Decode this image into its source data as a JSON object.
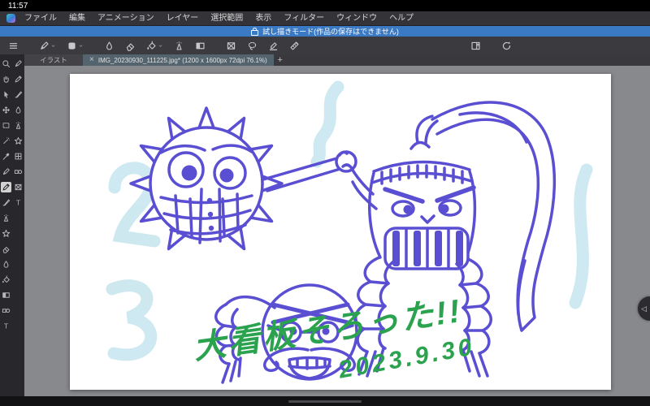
{
  "status_bar": {
    "time": "11:57"
  },
  "menu_bar": {
    "items": [
      "ファイル",
      "編集",
      "アニメーション",
      "レイヤー",
      "選択範囲",
      "表示",
      "フィルター",
      "ウィンドウ",
      "ヘルプ"
    ]
  },
  "banner": {
    "text": "試し描きモード(作品の保存はできません)"
  },
  "toolbar": {
    "left": [
      {
        "name": "main-menu",
        "icon": "menu"
      },
      {
        "name": "current-tool",
        "icon": "pen",
        "chevron": true
      },
      {
        "name": "color-swatch",
        "icon": "swatch",
        "chevron": true
      },
      {
        "name": "blend-tool",
        "icon": "droplet"
      },
      {
        "name": "eraser-tool",
        "icon": "eraser"
      },
      {
        "name": "fill-tool",
        "icon": "bucket",
        "chevron": true
      },
      {
        "name": "airbrush-tool",
        "icon": "airbrush"
      },
      {
        "name": "gradient-tool",
        "icon": "gradient"
      },
      {
        "name": "selection-tool",
        "icon": "selectx"
      },
      {
        "name": "lasso-tool",
        "icon": "lasso"
      },
      {
        "name": "figure-tool",
        "icon": "penline"
      },
      {
        "name": "ruler-tool",
        "icon": "ruler"
      }
    ],
    "right": [
      {
        "name": "panel-layout",
        "icon": "panel"
      },
      {
        "name": "reset-rotation",
        "icon": "rotate"
      }
    ]
  },
  "tab_bar": {
    "workspace": "イラスト",
    "close": "×",
    "title": "IMG_20230930_111225.jpg* (1200 x 1600px 72dpi 76.1%)",
    "add": "+"
  },
  "tool_palette": {
    "column1": [
      {
        "name": "zoom",
        "icon": "zoom"
      },
      {
        "name": "hand",
        "icon": "hand"
      },
      {
        "name": "operation",
        "icon": "cursor"
      },
      {
        "name": "layer-move",
        "icon": "movelayer"
      },
      {
        "name": "selection",
        "icon": "select"
      },
      {
        "name": "auto-select",
        "icon": "wand"
      },
      {
        "name": "eyedropper",
        "icon": "eyedrop"
      },
      {
        "name": "pen",
        "icon": "pen"
      },
      {
        "name": "pencil",
        "icon": "pencil",
        "selected": true
      },
      {
        "name": "brush",
        "icon": "brush"
      },
      {
        "name": "airbrush",
        "icon": "airbrush"
      },
      {
        "name": "decoration",
        "icon": "decoration"
      },
      {
        "name": "eraser",
        "icon": "eraser"
      },
      {
        "name": "blend",
        "icon": "droplet"
      },
      {
        "name": "fill",
        "icon": "bucket"
      },
      {
        "name": "gradient",
        "icon": "gradient"
      },
      {
        "name": "figure",
        "icon": "figure"
      },
      {
        "name": "text",
        "icon": "text"
      }
    ],
    "column2": [
      {
        "name": "subtool-1",
        "icon": "pen"
      },
      {
        "name": "subtool-2",
        "icon": "pencil"
      },
      {
        "name": "subtool-3",
        "icon": "brush"
      },
      {
        "name": "subtool-4",
        "icon": "droplet"
      },
      {
        "name": "subtool-5",
        "icon": "airbrush"
      },
      {
        "name": "subtool-6",
        "icon": "decoration"
      },
      {
        "name": "subtool-7",
        "icon": "grid"
      },
      {
        "name": "subtool-8",
        "icon": "figure"
      },
      {
        "name": "subtool-9",
        "icon": "selectx"
      },
      {
        "name": "subtool-10",
        "icon": "text"
      }
    ]
  },
  "canvas": {
    "caption_line1": "大看板そろった!!",
    "caption_line2": "2023.9.30",
    "ink_color": "#5a4fd2",
    "wash_color": "#c6e5ee",
    "caption_color": "#2aa24e"
  },
  "side_handle": {
    "icon": "◁"
  }
}
